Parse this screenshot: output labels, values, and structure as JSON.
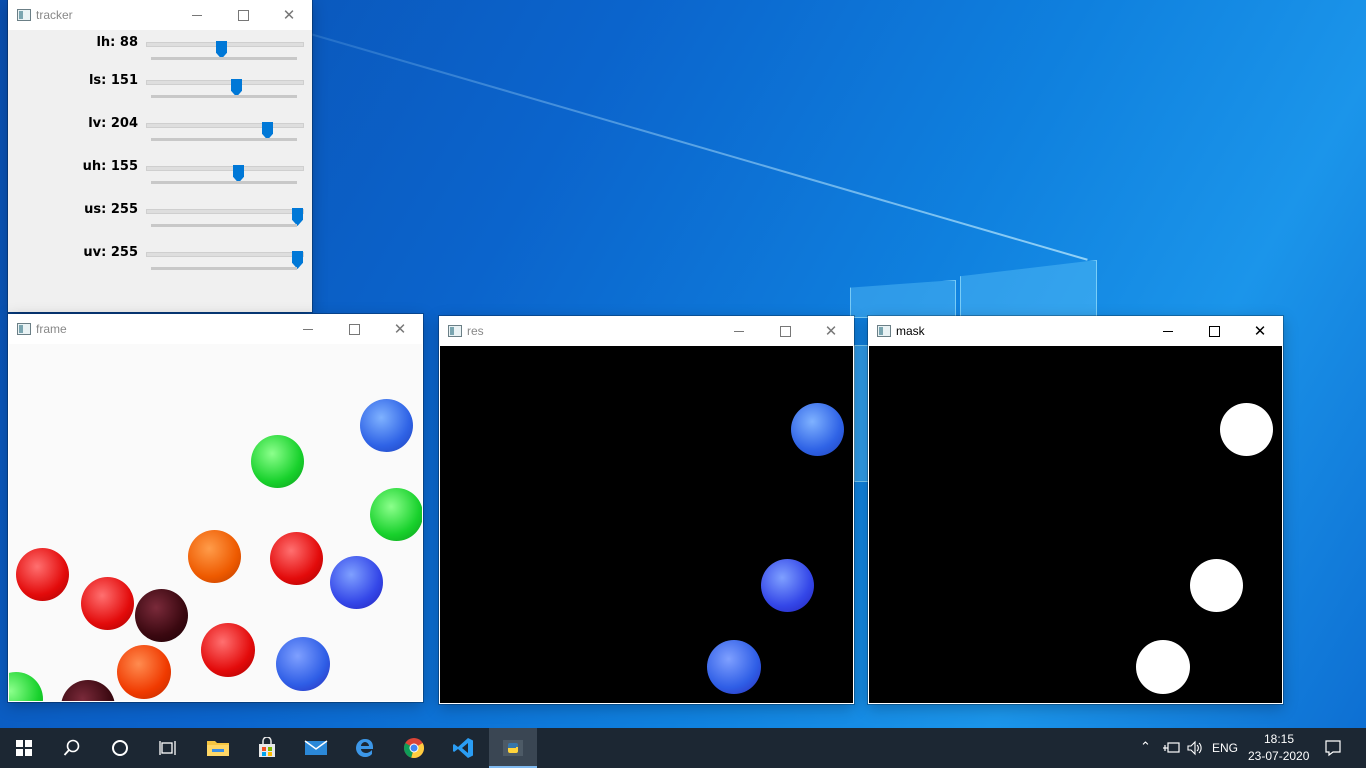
{
  "taskbar": {
    "tray": {
      "language": "ENG",
      "time": "18:15",
      "date": "23-07-2020"
    },
    "pinned": [
      "windows-start-icon",
      "search-icon",
      "cortana-icon",
      "task-view-icon",
      "file-explorer-icon",
      "store-icon",
      "mail-icon",
      "edge-icon",
      "chrome-icon",
      "vscode-icon",
      "python-icon"
    ]
  },
  "windows": {
    "tracker": {
      "title": "tracker",
      "sliders": [
        {
          "label": "lh: 88",
          "value": 88,
          "max": 179
        },
        {
          "label": "ls: 151",
          "value": 151,
          "max": 255
        },
        {
          "label": "lv: 204",
          "value": 204,
          "max": 255
        },
        {
          "label": "uh: 155",
          "value": 155,
          "max": 255
        },
        {
          "label": "us: 255",
          "value": 255,
          "max": 255
        },
        {
          "label": "uv: 255",
          "value": 255,
          "max": 255
        }
      ]
    },
    "frame": {
      "title": "frame"
    },
    "res": {
      "title": "res"
    },
    "mask": {
      "title": "mask"
    }
  },
  "colors": {
    "accent": "#0078d7",
    "taskbar": "#1c2733",
    "desktop": "#0b64cc"
  }
}
